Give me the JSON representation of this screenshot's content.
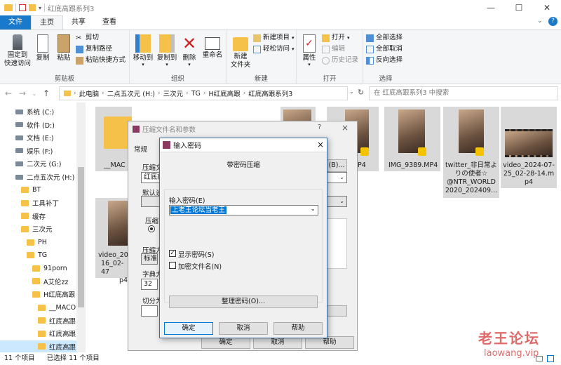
{
  "window": {
    "title": "红底高跟系列3"
  },
  "tabs": [
    {
      "label": "文件"
    },
    {
      "label": "主页"
    },
    {
      "label": "共享"
    },
    {
      "label": "查看"
    }
  ],
  "ribbon": {
    "clipboard": {
      "pin_line1": "固定到",
      "pin_line2": "快速访问",
      "copy": "复制",
      "paste": "粘贴",
      "cut": "剪切",
      "copy_path": "复制路径",
      "paste_shortcut": "粘贴快捷方式",
      "group": "剪贴板"
    },
    "organize": {
      "move_to": "移动到",
      "copy_to": "复制到",
      "delete": "删除",
      "rename": "重命名",
      "group": "组织"
    },
    "new": {
      "new_folder_line1": "新建",
      "new_folder_line2": "文件夹",
      "new_item": "新建项目",
      "easy_access": "轻松访问",
      "group": "新建"
    },
    "open": {
      "properties": "属性",
      "open": "打开",
      "edit": "编辑",
      "history": "历史记录",
      "group": "打开"
    },
    "select": {
      "select_all": "全部选择",
      "select_none": "全部取消",
      "invert": "反向选择",
      "group": "选择"
    }
  },
  "address": {
    "crumbs": [
      "此电脑",
      "二点五次元 (H:)",
      "三次元",
      "TG",
      "H红底高跟",
      "红底高跟系列3"
    ],
    "search_placeholder": "在 红底高跟系列3 中搜索"
  },
  "navpane": [
    {
      "label": "系统 (C:)",
      "type": "drive",
      "indent": 1
    },
    {
      "label": "软件 (D:)",
      "type": "drive",
      "indent": 1
    },
    {
      "label": "文档 (E:)",
      "type": "drive",
      "indent": 1
    },
    {
      "label": "娱乐 (F:)",
      "type": "drive",
      "indent": 1
    },
    {
      "label": "二次元 (G:)",
      "type": "drive",
      "indent": 1
    },
    {
      "label": "二点五次元 (H:)",
      "type": "drive",
      "indent": 1
    },
    {
      "label": "BT",
      "type": "folder",
      "indent": 2
    },
    {
      "label": "工具补丁",
      "type": "folder",
      "indent": 2
    },
    {
      "label": "缓存",
      "type": "folder",
      "indent": 2
    },
    {
      "label": "三次元",
      "type": "folder",
      "indent": 2
    },
    {
      "label": "PH",
      "type": "folder",
      "indent": 3
    },
    {
      "label": "TG",
      "type": "folder",
      "indent": 3
    },
    {
      "label": "91porn",
      "type": "folder",
      "indent": 4
    },
    {
      "label": "A艾伦zz",
      "type": "folder",
      "indent": 4
    },
    {
      "label": "H红底高跟",
      "type": "folder",
      "indent": 4
    },
    {
      "label": "__MACOS",
      "type": "folder",
      "indent": 5
    },
    {
      "label": "红底高跟系",
      "type": "folder",
      "indent": 5
    },
    {
      "label": "红底高跟系",
      "type": "folder",
      "indent": 5
    },
    {
      "label": "红底高跟系",
      "type": "folder",
      "indent": 5,
      "selected": true
    }
  ],
  "files": {
    "macos": "__MAC",
    "mp4_partial": "P4",
    "img9389": "IMG_9389.MP4",
    "twitter": [
      "twitter_非日常よ",
      "りの使者☆",
      "@NTR_WORLD",
      "2020_202409..."
    ],
    "video0725": [
      "video_2024-07-",
      "25_02-28-14.m",
      "p4"
    ],
    "video_partial": [
      "video_20",
      "16_02-47",
      "p4"
    ]
  },
  "status": {
    "count": "11 个项目",
    "selected": "已选择 11 个项目"
  },
  "archive_dialog": {
    "title": "压缩文件名和参数",
    "tab_general": "常规",
    "label_archive": "压缩文",
    "value_archive": "红底高",
    "label_default": "默认设",
    "label_format": "压缩",
    "label_method": "压缩方",
    "value_method": "标准",
    "label_dict": "字典大",
    "value_dict": "32",
    "label_split": "切分为",
    "browse": "(B)...",
    "ok": "确定",
    "cancel": "取消",
    "help": "帮助",
    "question": "?",
    "close": "×"
  },
  "password_dialog": {
    "title": "输入密码",
    "heading": "带密码压缩",
    "label_password": "输入密码(E)",
    "value_password": "上老王论坛当老王",
    "show_password": "显示密码(S)",
    "encrypt_names": "加密文件名(N)",
    "organize": "整理密码(O)...",
    "ok": "确定",
    "cancel": "取消",
    "help": "帮助",
    "close": "×"
  },
  "watermark": {
    "line1": "老王论坛",
    "line2": "laowang.vip"
  }
}
